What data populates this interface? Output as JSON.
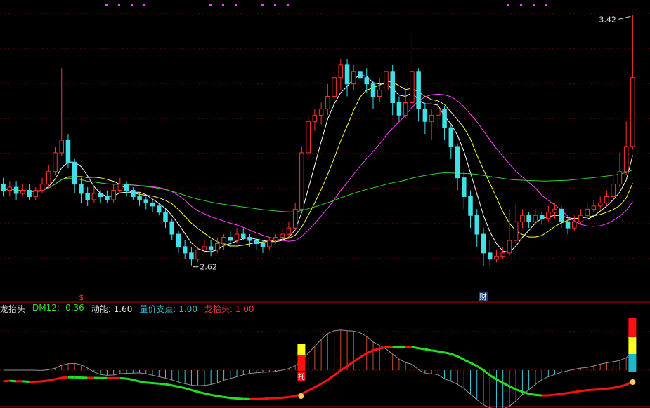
{
  "title_fragment": "",
  "legend": [
    {
      "key": "name",
      "label": "龙抬头",
      "color": "#d8d8d8"
    },
    {
      "key": "dm12",
      "label": "DM12: -0.36",
      "color": "#33e033"
    },
    {
      "key": "energy",
      "label": "动能: 1.60",
      "color": "#e0e0e0"
    },
    {
      "key": "vol_support",
      "label": "量价支点: 1.00",
      "color": "#34b6d0"
    },
    {
      "key": "dragon",
      "label": "龙抬头: 1.00",
      "color": "#ff3030"
    }
  ],
  "annotations": {
    "high_label": "3.42",
    "low_label": "2.62",
    "marker_s": "$",
    "marker_cai": "财",
    "marker_tuo": "托"
  },
  "colors": {
    "background": "#000000",
    "up": "#ff3030",
    "down": "#40e0e8",
    "ma5": "#ffffff",
    "ma10": "#ffff40",
    "ma20": "#ff40ff",
    "ma60": "#30d030",
    "grid": "#8a0000",
    "osc_red": "#ff1010",
    "osc_green": "#20e020"
  },
  "chart_data": {
    "type": "candlestick",
    "price_range": [
      2.55,
      3.45
    ],
    "high": 3.42,
    "low": 2.62,
    "candles": [
      [
        2.88,
        2.86,
        2.9,
        2.84
      ],
      [
        2.86,
        2.87,
        2.89,
        2.84
      ],
      [
        2.87,
        2.85,
        2.89,
        2.83
      ],
      [
        2.85,
        2.86,
        2.88,
        2.84
      ],
      [
        2.86,
        2.84,
        2.88,
        2.83
      ],
      [
        2.84,
        2.86,
        2.87,
        2.83
      ],
      [
        2.86,
        2.88,
        2.9,
        2.85
      ],
      [
        2.88,
        2.92,
        2.94,
        2.87
      ],
      [
        2.92,
        2.98,
        3.0,
        2.91
      ],
      [
        2.98,
        3.02,
        3.25,
        2.97
      ],
      [
        3.02,
        2.95,
        3.04,
        2.93
      ],
      [
        2.95,
        2.88,
        2.96,
        2.85
      ],
      [
        2.88,
        2.85,
        2.9,
        2.82
      ],
      [
        2.85,
        2.83,
        2.87,
        2.81
      ],
      [
        2.83,
        2.85,
        2.87,
        2.82
      ],
      [
        2.85,
        2.84,
        2.86,
        2.82
      ],
      [
        2.84,
        2.83,
        2.86,
        2.82
      ],
      [
        2.83,
        2.86,
        2.88,
        2.82
      ],
      [
        2.86,
        2.88,
        2.9,
        2.85
      ],
      [
        2.88,
        2.86,
        2.89,
        2.84
      ],
      [
        2.86,
        2.84,
        2.87,
        2.83
      ],
      [
        2.84,
        2.83,
        2.85,
        2.81
      ],
      [
        2.83,
        2.82,
        2.84,
        2.8
      ],
      [
        2.82,
        2.81,
        2.83,
        2.79
      ],
      [
        2.81,
        2.79,
        2.82,
        2.78
      ],
      [
        2.79,
        2.76,
        2.8,
        2.74
      ],
      [
        2.76,
        2.72,
        2.77,
        2.7
      ],
      [
        2.72,
        2.68,
        2.73,
        2.66
      ],
      [
        2.68,
        2.66,
        2.7,
        2.64
      ],
      [
        2.66,
        2.64,
        2.68,
        2.62
      ],
      [
        2.64,
        2.67,
        2.68,
        2.63
      ],
      [
        2.67,
        2.68,
        2.7,
        2.66
      ],
      [
        2.68,
        2.67,
        2.7,
        2.65
      ],
      [
        2.67,
        2.69,
        2.71,
        2.66
      ],
      [
        2.69,
        2.71,
        2.72,
        2.67
      ],
      [
        2.71,
        2.7,
        2.73,
        2.68
      ],
      [
        2.7,
        2.72,
        2.74,
        2.69
      ],
      [
        2.72,
        2.71,
        2.74,
        2.7
      ],
      [
        2.71,
        2.7,
        2.72,
        2.68
      ],
      [
        2.7,
        2.69,
        2.71,
        2.67
      ],
      [
        2.69,
        2.68,
        2.7,
        2.66
      ],
      [
        2.68,
        2.7,
        2.71,
        2.67
      ],
      [
        2.7,
        2.71,
        2.72,
        2.69
      ],
      [
        2.71,
        2.72,
        2.74,
        2.7
      ],
      [
        2.72,
        2.74,
        2.76,
        2.71
      ],
      [
        2.74,
        2.8,
        2.82,
        2.73
      ],
      [
        2.8,
        2.98,
        3.0,
        2.79
      ],
      [
        2.98,
        3.08,
        3.1,
        2.96
      ],
      [
        3.08,
        3.1,
        3.12,
        3.05
      ],
      [
        3.1,
        3.12,
        3.14,
        3.07
      ],
      [
        3.12,
        3.16,
        3.2,
        3.1
      ],
      [
        3.16,
        3.22,
        3.24,
        3.14
      ],
      [
        3.22,
        3.26,
        3.28,
        3.18
      ],
      [
        3.26,
        3.2,
        3.28,
        3.16
      ],
      [
        3.2,
        3.24,
        3.26,
        3.18
      ],
      [
        3.24,
        3.22,
        3.27,
        3.19
      ],
      [
        3.22,
        3.2,
        3.25,
        3.17
      ],
      [
        3.2,
        3.16,
        3.21,
        3.12
      ],
      [
        3.16,
        3.18,
        3.22,
        3.14
      ],
      [
        3.18,
        3.24,
        3.25,
        3.16
      ],
      [
        3.24,
        3.14,
        3.26,
        3.1
      ],
      [
        3.14,
        3.1,
        3.16,
        3.08
      ],
      [
        3.1,
        3.14,
        3.18,
        3.09
      ],
      [
        3.14,
        3.24,
        3.36,
        3.12
      ],
      [
        3.24,
        3.12,
        3.25,
        3.08
      ],
      [
        3.12,
        3.08,
        3.14,
        3.04
      ],
      [
        3.08,
        3.1,
        3.12,
        3.02
      ],
      [
        3.1,
        3.12,
        3.14,
        3.06
      ],
      [
        3.12,
        3.06,
        3.13,
        3.02
      ],
      [
        3.06,
        3.0,
        3.07,
        2.96
      ],
      [
        3.0,
        2.9,
        3.01,
        2.86
      ],
      [
        2.9,
        2.84,
        2.92,
        2.8
      ],
      [
        2.84,
        2.78,
        2.86,
        2.74
      ],
      [
        2.78,
        2.72,
        2.8,
        2.68
      ],
      [
        2.72,
        2.66,
        2.74,
        2.62
      ],
      [
        2.66,
        2.64,
        2.7,
        2.62
      ],
      [
        2.64,
        2.65,
        2.67,
        2.63
      ],
      [
        2.65,
        2.66,
        2.68,
        2.64
      ],
      [
        2.66,
        2.7,
        2.8,
        2.65
      ],
      [
        2.7,
        2.76,
        2.82,
        2.69
      ],
      [
        2.76,
        2.78,
        2.8,
        2.74
      ],
      [
        2.78,
        2.76,
        2.79,
        2.74
      ],
      [
        2.76,
        2.78,
        2.8,
        2.75
      ],
      [
        2.78,
        2.77,
        2.79,
        2.75
      ],
      [
        2.77,
        2.79,
        2.81,
        2.76
      ],
      [
        2.79,
        2.8,
        2.82,
        2.77
      ],
      [
        2.8,
        2.76,
        2.81,
        2.74
      ],
      [
        2.76,
        2.74,
        2.77,
        2.72
      ],
      [
        2.74,
        2.76,
        2.78,
        2.73
      ],
      [
        2.76,
        2.78,
        2.8,
        2.75
      ],
      [
        2.78,
        2.8,
        2.82,
        2.77
      ],
      [
        2.8,
        2.81,
        2.83,
        2.79
      ],
      [
        2.81,
        2.82,
        2.84,
        2.8
      ],
      [
        2.82,
        2.84,
        2.86,
        2.81
      ],
      [
        2.84,
        2.88,
        2.9,
        2.83
      ],
      [
        2.88,
        2.92,
        2.98,
        2.87
      ],
      [
        2.92,
        3.0,
        3.08,
        2.91
      ],
      [
        3.0,
        3.22,
        3.42,
        2.99
      ]
    ],
    "ma_periods": [
      5,
      10,
      20,
      60
    ],
    "oscillator": {
      "range": [
        -1.2,
        1.2
      ],
      "markers": [
        {
          "index": 46,
          "label": "托"
        },
        {
          "index": 97,
          "label": ""
        }
      ]
    }
  }
}
